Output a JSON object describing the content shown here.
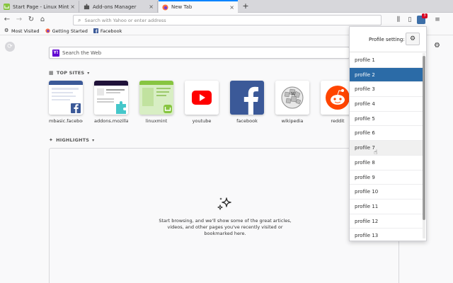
{
  "tabs": [
    {
      "label": "Start Page - Linux Mint",
      "close": "×"
    },
    {
      "label": "Add-ons Manager",
      "close": "×"
    },
    {
      "label": "New Tab",
      "close": "×"
    }
  ],
  "new_tab": "+",
  "nav": {
    "back": "←",
    "forward": "→",
    "reload": "↻",
    "home": "⌂",
    "url_placeholder": "Search with Yahoo or enter address",
    "library": "⫼",
    "sidebar": "▯",
    "ext_badge": "3",
    "menu": "≡"
  },
  "bookmarks": [
    {
      "label": "Most Visited"
    },
    {
      "label": "Getting Started"
    },
    {
      "label": "Facebook"
    }
  ],
  "search": {
    "logo": "Y!",
    "placeholder": "Search the Web"
  },
  "top_sites": {
    "heading": "TOP SITES",
    "items": [
      {
        "name": "mbasic.facebook"
      },
      {
        "name": "addons.mozilla"
      },
      {
        "name": "linuxmint"
      },
      {
        "name": "youtube"
      },
      {
        "name": "facebook"
      },
      {
        "name": "wikipedia"
      },
      {
        "name": "reddit"
      }
    ]
  },
  "highlights": {
    "heading": "HIGHLIGHTS",
    "empty_message": "Start browsing, and we'll show some of the great articles, videos, and other pages you've recently visited or bookmarked here."
  },
  "profile_popup": {
    "title": "Profile setting:",
    "gear": "⚙",
    "selected_index": 1,
    "hover_index": 6,
    "profiles": [
      "profile 1",
      "profile 2",
      "profile 3",
      "profile 4",
      "profile 5",
      "profile 6",
      "profile 7",
      "profile 8",
      "profile 9",
      "profile 10",
      "profile 11",
      "profile 12",
      "profile 13"
    ]
  },
  "colors": {
    "accent": "#0a84ff",
    "selected": "#2b6ba7",
    "yahoo": "#6001d2"
  }
}
